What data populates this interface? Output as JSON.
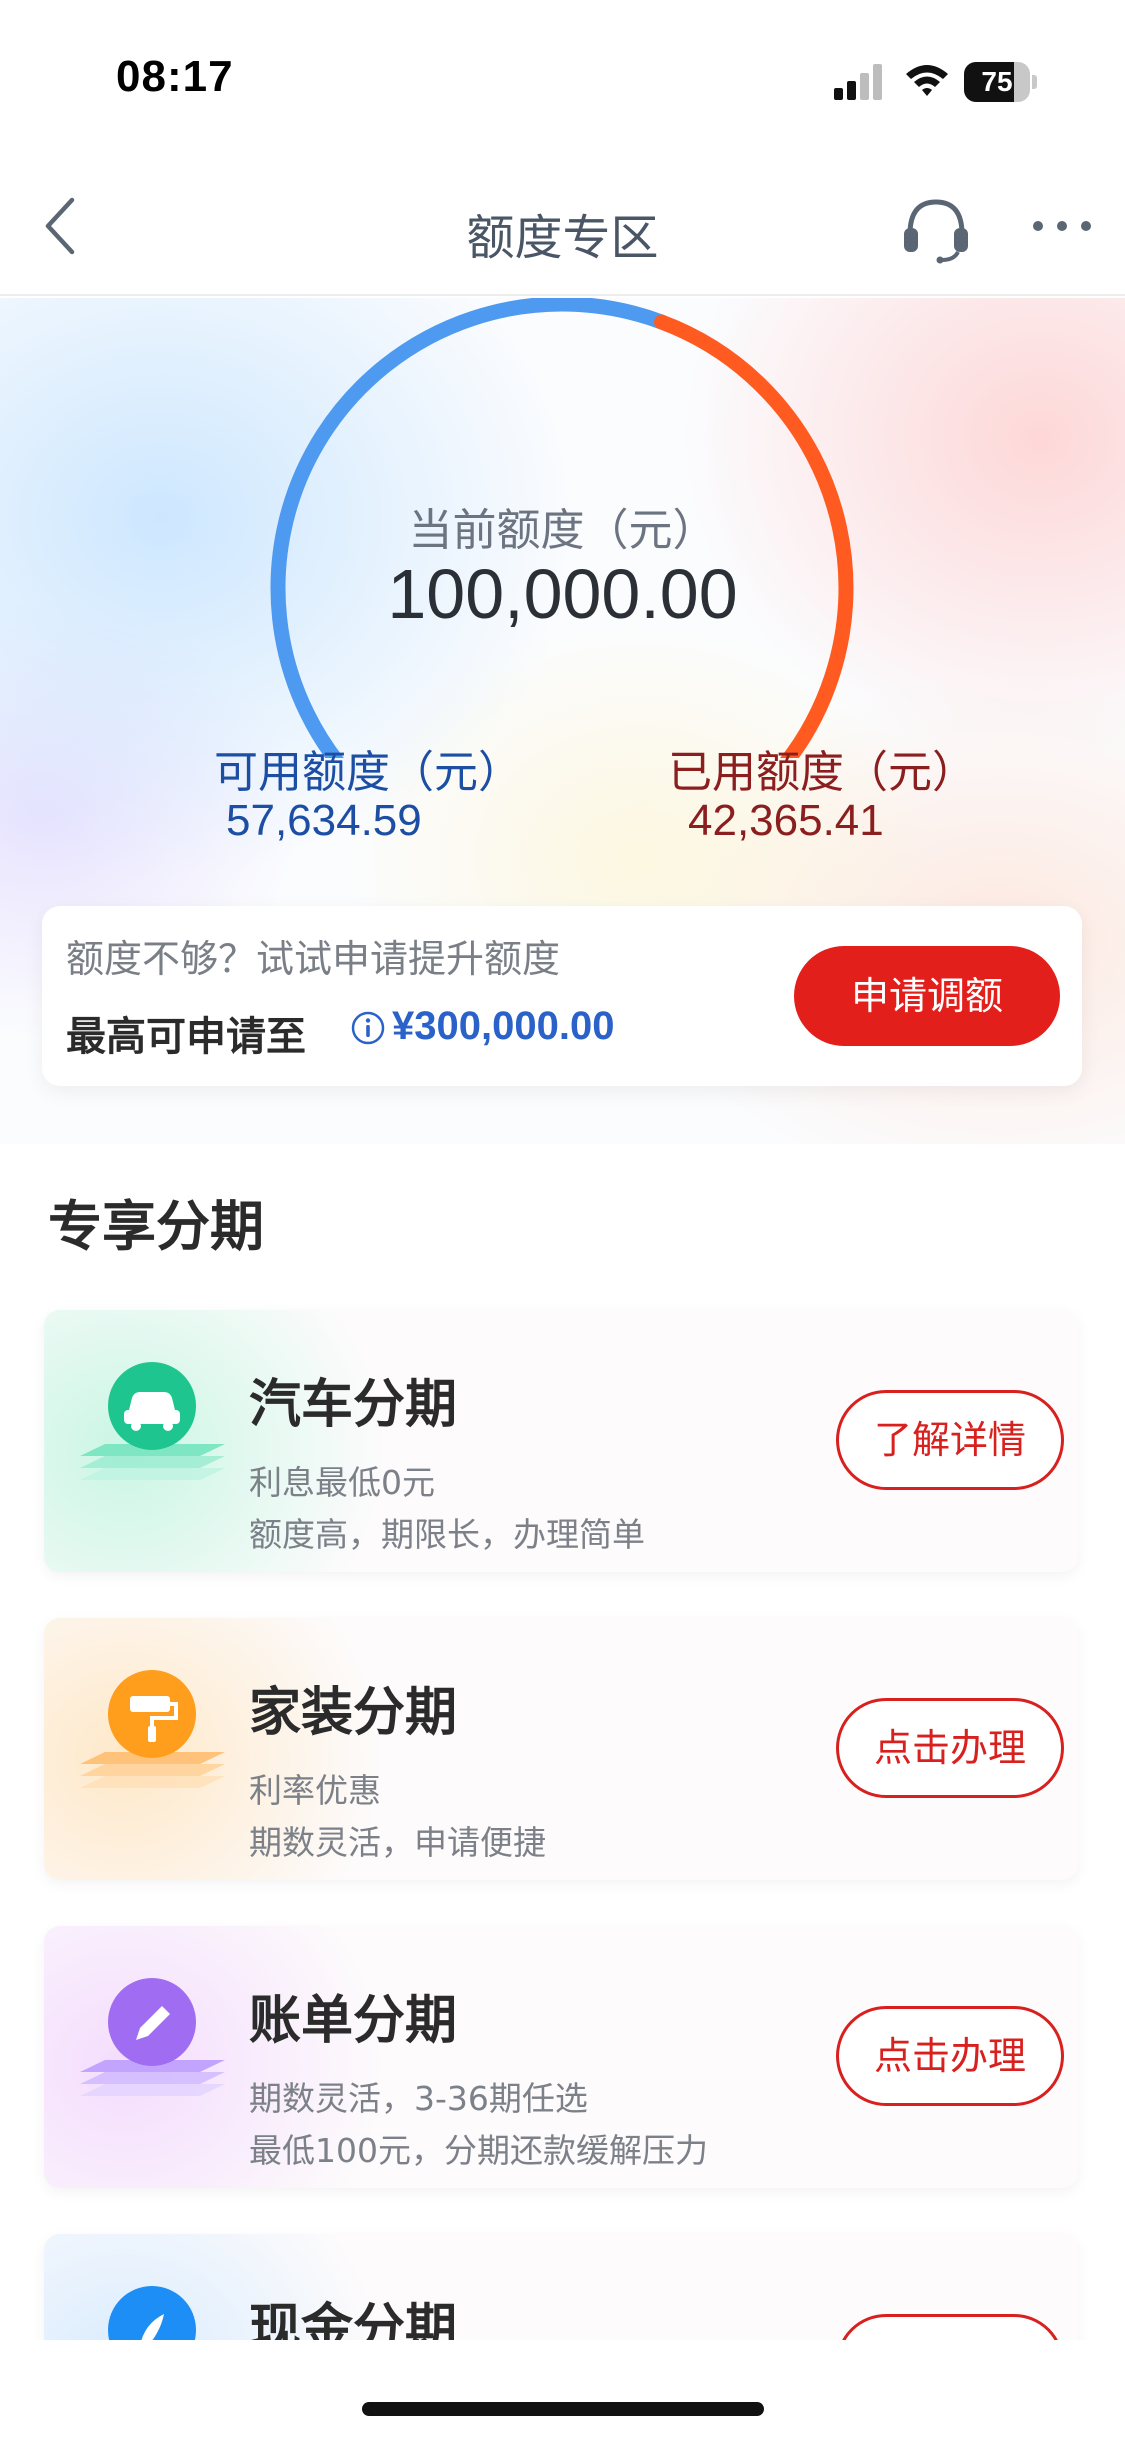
{
  "status_bar": {
    "time": "08:17",
    "battery": "75",
    "battery_level": 0.75
  },
  "nav": {
    "title": "额度专区",
    "icons": [
      "back-icon",
      "headset-icon",
      "more-icon"
    ]
  },
  "limit": {
    "current_label": "当前额度（元）",
    "current_value": "100,000.00",
    "available_label": "可用额度（元）",
    "available_value": "57,634.59",
    "used_label": "已用额度（元）",
    "used_value": "42,365.41",
    "used_fraction": 0.424,
    "colors": {
      "available": "#4e9af1",
      "used": "#ff5a20"
    }
  },
  "raise": {
    "hint": "额度不够？试试申请提升额度",
    "prefix": "最高可申请至",
    "amount": "¥300,000.00",
    "button": "申请调额"
  },
  "section": {
    "title": "专享分期"
  },
  "products": [
    {
      "title": "汽车分期",
      "line1": "利息最低0元",
      "line2": "额度高，期限长，办理简单",
      "button": "了解详情",
      "icon": "car-icon",
      "color": "#1fc58e"
    },
    {
      "title": "家装分期",
      "line1": "利率优惠",
      "line2": "期数灵活，申请便捷",
      "button": "点击办理",
      "icon": "paint-roller-icon",
      "color": "#ff9d1c"
    },
    {
      "title": "账单分期",
      "line1": "期数灵活，3-36期任选",
      "line2": "最低100元，分期还款缓解压力",
      "button": "点击办理",
      "icon": "pen-icon",
      "color": "#a06cf2"
    },
    {
      "title": "现金分期",
      "line1": "",
      "line2": "",
      "button": "",
      "icon": "rocket-icon",
      "color": "#1c8ef5"
    }
  ]
}
